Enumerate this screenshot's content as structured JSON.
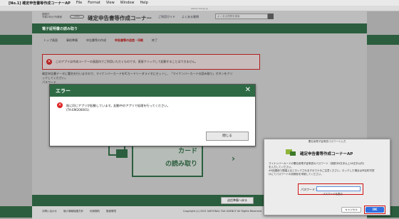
{
  "menubar": {
    "app": "[No.1] 確定申告書等作成コーナーAP",
    "items": [
      "File",
      "Format",
      "View",
      "Window",
      "Help"
    ]
  },
  "browser": {
    "url": "keisan.nta.go.jp"
  },
  "header": {
    "org_line1": "国税庁",
    "org_line2": "令和2年分 所得税",
    "etax": "e-Tax",
    "title": "確定申告書等作成コーナー",
    "guide": "ご利用ガイド",
    "faq": "よくある質問",
    "search_placeholder": "よくある質問を検索"
  },
  "section_title": "電子証明書の読み取り",
  "steps": [
    "トップ画面",
    "事前準備",
    "申告書等の作成",
    "申告書等の送信・印刷",
    "終了"
  ],
  "active_step": 3,
  "error_banner": "このアプリは作成コーナーの画面内でご利用いただくものです。直接クリックして起動することはできません。",
  "body_text": [
    "確定申告書データに署名を行いますので、マイナンバーカードをICカードリーダライタにセットし、「マイナンバーカードの読み取り」ボタンをクリ",
    "ックしてください。",
    "パスワード"
  ],
  "card_button": {
    "line1": "カード",
    "line2": "の読み取り"
  },
  "footer_bar_button": "送信準備へ戻る",
  "footer": {
    "links": [
      "お問い合わせ",
      "個人情報保護方針",
      "利用規約",
      "推奨環境"
    ],
    "copyright": "Copyright (c) 2021 NATIONAL TAX AGENCY All Rights Reserved."
  },
  "dialog": {
    "title": "エラー",
    "message_line1": "既に同じアプリが起動しています。起動中のアプリで処理を行ってください。",
    "message_line2": "(TA-EM200001)",
    "close_label": "閉じる"
  },
  "ap_dialog": {
    "window_title": "署名用電子証明書パスワード入力",
    "app_name": "確定申告書等作成コーナーAP",
    "desc_line1": "マイナンバーカードの署名用電子証明書のパスワード（英数字6文字以上16文字以内）",
    "desc_line2": "を入力してください。",
    "desc_line3": "※5回連続で間違えるとロックされますので十分ご注意ください。ロックした場合は市区町村窓",
    "desc_line4": "口にてパスワードの初期化を申請してください。",
    "password_label": "パスワード：",
    "password_value": "",
    "show_password": "パスワードを表示",
    "cancel": "キャンセル",
    "ok": "OK"
  },
  "colors": {
    "green": "#2b5e3e",
    "error_red": "#d01010",
    "ok_blue": "#2f6fe0"
  }
}
